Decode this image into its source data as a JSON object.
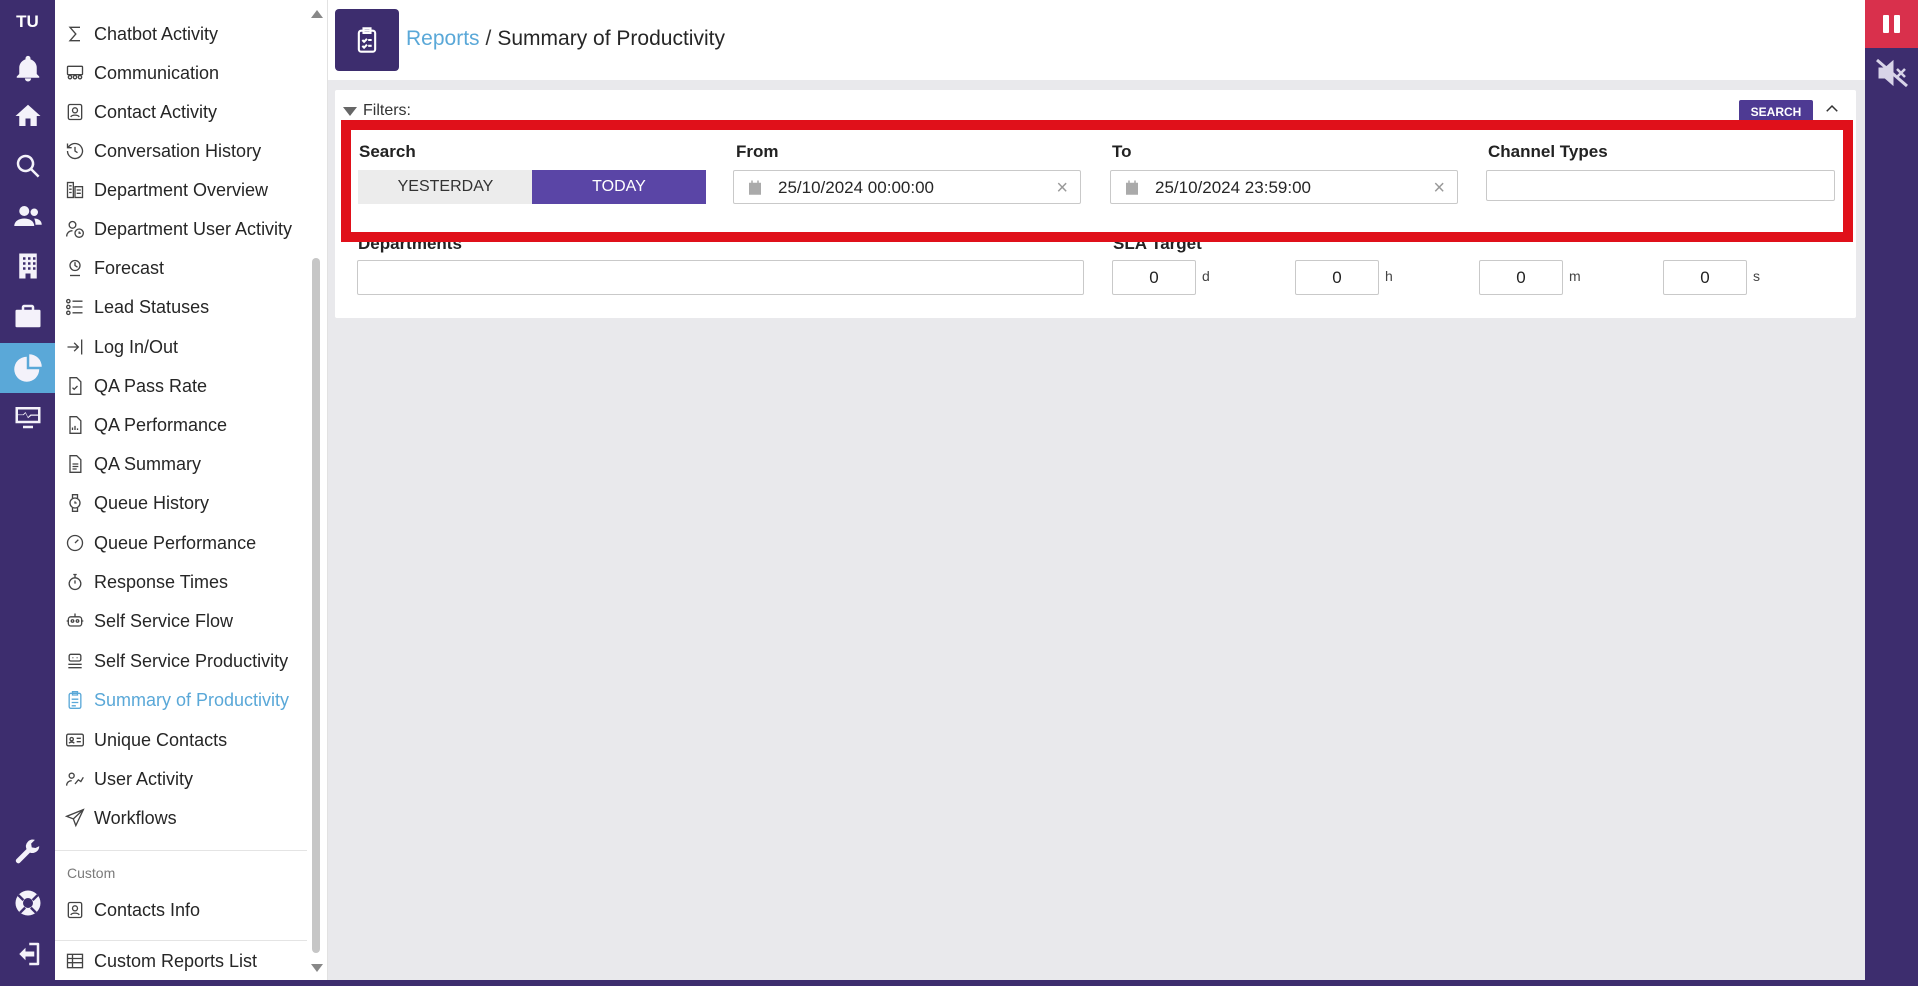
{
  "rail": {
    "initials": "TU",
    "icons": [
      "bell-icon",
      "home-icon",
      "search-icon",
      "users-icon",
      "building-icon",
      "briefcase-icon",
      "reports-pie-icon",
      "monitor-icon",
      "wrench-icon",
      "support-icon",
      "logout-icon"
    ]
  },
  "sidebar": {
    "items": [
      {
        "label": "Chatbot Activity",
        "icon": "sigma-icon"
      },
      {
        "label": "Communication",
        "icon": "group-icon"
      },
      {
        "label": "Contact Activity",
        "icon": "contact-card-icon"
      },
      {
        "label": "Conversation History",
        "icon": "history-icon"
      },
      {
        "label": "Department Overview",
        "icon": "department-icon"
      },
      {
        "label": "Department User Activity",
        "icon": "user-clock-icon"
      },
      {
        "label": "Forecast",
        "icon": "forecast-icon"
      },
      {
        "label": "Lead Statuses",
        "icon": "list-users-icon"
      },
      {
        "label": "Log In/Out",
        "icon": "login-icon"
      },
      {
        "label": "QA Pass Rate",
        "icon": "file-check-icon"
      },
      {
        "label": "QA Performance",
        "icon": "file-chart-icon"
      },
      {
        "label": "QA Summary",
        "icon": "file-text-icon"
      },
      {
        "label": "Queue History",
        "icon": "watch-icon"
      },
      {
        "label": "Queue Performance",
        "icon": "gauge-icon"
      },
      {
        "label": "Response Times",
        "icon": "stopwatch-icon"
      },
      {
        "label": "Self Service Flow",
        "icon": "robot-icon"
      },
      {
        "label": "Self Service Productivity",
        "icon": "robot-stack-icon"
      },
      {
        "label": "Summary of Productivity",
        "icon": "clipboard-icon"
      },
      {
        "label": "Unique Contacts",
        "icon": "id-card-icon"
      },
      {
        "label": "User Activity",
        "icon": "user-chart-icon"
      },
      {
        "label": "Workflows",
        "icon": "send-icon"
      }
    ],
    "active": "Summary of Productivity",
    "custom_section": "Custom",
    "custom_items": [
      {
        "label": "Contacts Info",
        "icon": "contact-card-icon"
      },
      {
        "label": "Custom Reports List",
        "icon": "table-icon"
      }
    ]
  },
  "header": {
    "breadcrumb_link": "Reports",
    "separator": "/",
    "title": "Summary of Productivity"
  },
  "filters": {
    "label": "Filters:",
    "search_button": "SEARCH",
    "search_label": "Search",
    "yesterday": "YESTERDAY",
    "today": "TODAY",
    "from_label": "From",
    "from_value": "25/10/2024 00:00:00",
    "to_label": "To",
    "to_value": "25/10/2024 23:59:00",
    "channel_types_label": "Channel Types",
    "departments_label": "Departments",
    "sla_label": "SLA Target",
    "sla": [
      {
        "value": "0",
        "unit": "d"
      },
      {
        "value": "0",
        "unit": "h"
      },
      {
        "value": "0",
        "unit": "m"
      },
      {
        "value": "0",
        "unit": "s"
      }
    ],
    "clear_glyph": "×"
  },
  "colors": {
    "brand_purple": "#3d2d6e",
    "accent_purple": "#5a45a6",
    "link_blue": "#5aa8d8",
    "highlight_red": "#e0101a",
    "pause_red": "#d9304c"
  }
}
